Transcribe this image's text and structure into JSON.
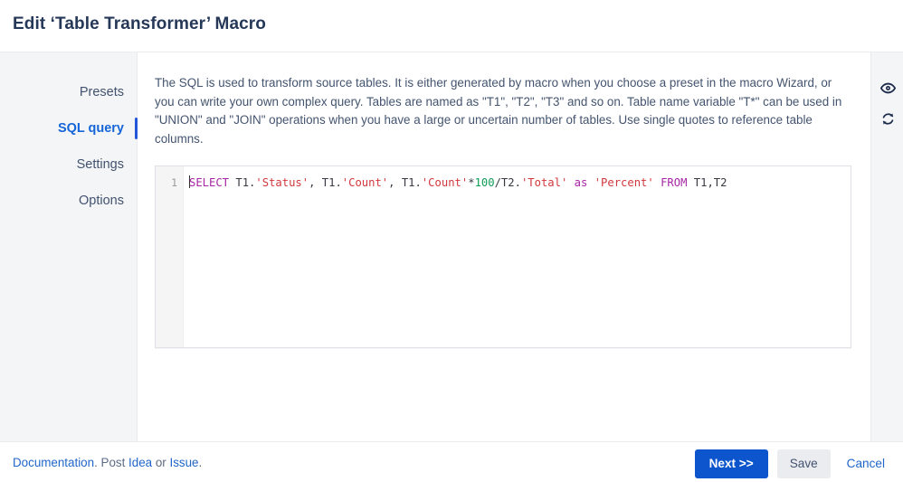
{
  "header": {
    "title": "Edit ‘Table Transformer’ Macro"
  },
  "sidebar": {
    "items": [
      {
        "label": "Presets",
        "active": false
      },
      {
        "label": "SQL query",
        "active": true
      },
      {
        "label": "Settings",
        "active": false
      },
      {
        "label": "Options",
        "active": false
      }
    ]
  },
  "main": {
    "description": "The SQL is used to transform source tables. It is either generated by macro when you choose a preset in the macro Wizard, or you can write your own complex query. Tables are named as \"T1\", \"T2\", \"T3\" and so on. Table name variable \"T*\" can be used in \"UNION\" and \"JOIN\" operations when you have a large or uncertain number of tables. Use single quotes to reference table columns.",
    "editor": {
      "line_number": "1",
      "full_text": "SELECT T1.'Status', T1.'Count', T1.'Count'*100/T2.'Total' as 'Percent' FROM T1,T2",
      "tokens": [
        {
          "text": "SELECT",
          "type": "keyword"
        },
        {
          "text": " T1.",
          "type": "plain"
        },
        {
          "text": "'Status'",
          "type": "string"
        },
        {
          "text": ", T1.",
          "type": "plain"
        },
        {
          "text": "'Count'",
          "type": "string"
        },
        {
          "text": ", T1.",
          "type": "plain"
        },
        {
          "text": "'Count'",
          "type": "string"
        },
        {
          "text": "*",
          "type": "plain"
        },
        {
          "text": "100",
          "type": "number"
        },
        {
          "text": "/T2.",
          "type": "plain"
        },
        {
          "text": "'Total'",
          "type": "string"
        },
        {
          "text": " ",
          "type": "plain"
        },
        {
          "text": "as",
          "type": "keyword"
        },
        {
          "text": " ",
          "type": "plain"
        },
        {
          "text": "'Percent'",
          "type": "string"
        },
        {
          "text": " ",
          "type": "plain"
        },
        {
          "text": "FROM",
          "type": "keyword"
        },
        {
          "text": " T1,T2",
          "type": "plain"
        }
      ]
    }
  },
  "right_rail": {
    "icons": [
      {
        "name": "eye-icon",
        "title": "Preview"
      },
      {
        "name": "refresh-icon",
        "title": "Refresh"
      }
    ]
  },
  "footer": {
    "links": {
      "documentation": "Documentation",
      "text_after_documentation": ". Post ",
      "idea": "Idea",
      "text_between": " or ",
      "issue": "Issue",
      "text_end": "."
    },
    "buttons": {
      "next": "Next >>",
      "save": "Save",
      "cancel": "Cancel"
    }
  },
  "colors": {
    "primary": "#0c55cc",
    "link": "#2066c9",
    "active_nav": "#1565d8",
    "active_bar": "#2157d8",
    "sidebar_bg": "#f4f5f7",
    "text": "#253858",
    "muted_text": "#44546f",
    "keyword": "#a626a4",
    "string": "#d1383d",
    "number": "#0f9e57"
  }
}
